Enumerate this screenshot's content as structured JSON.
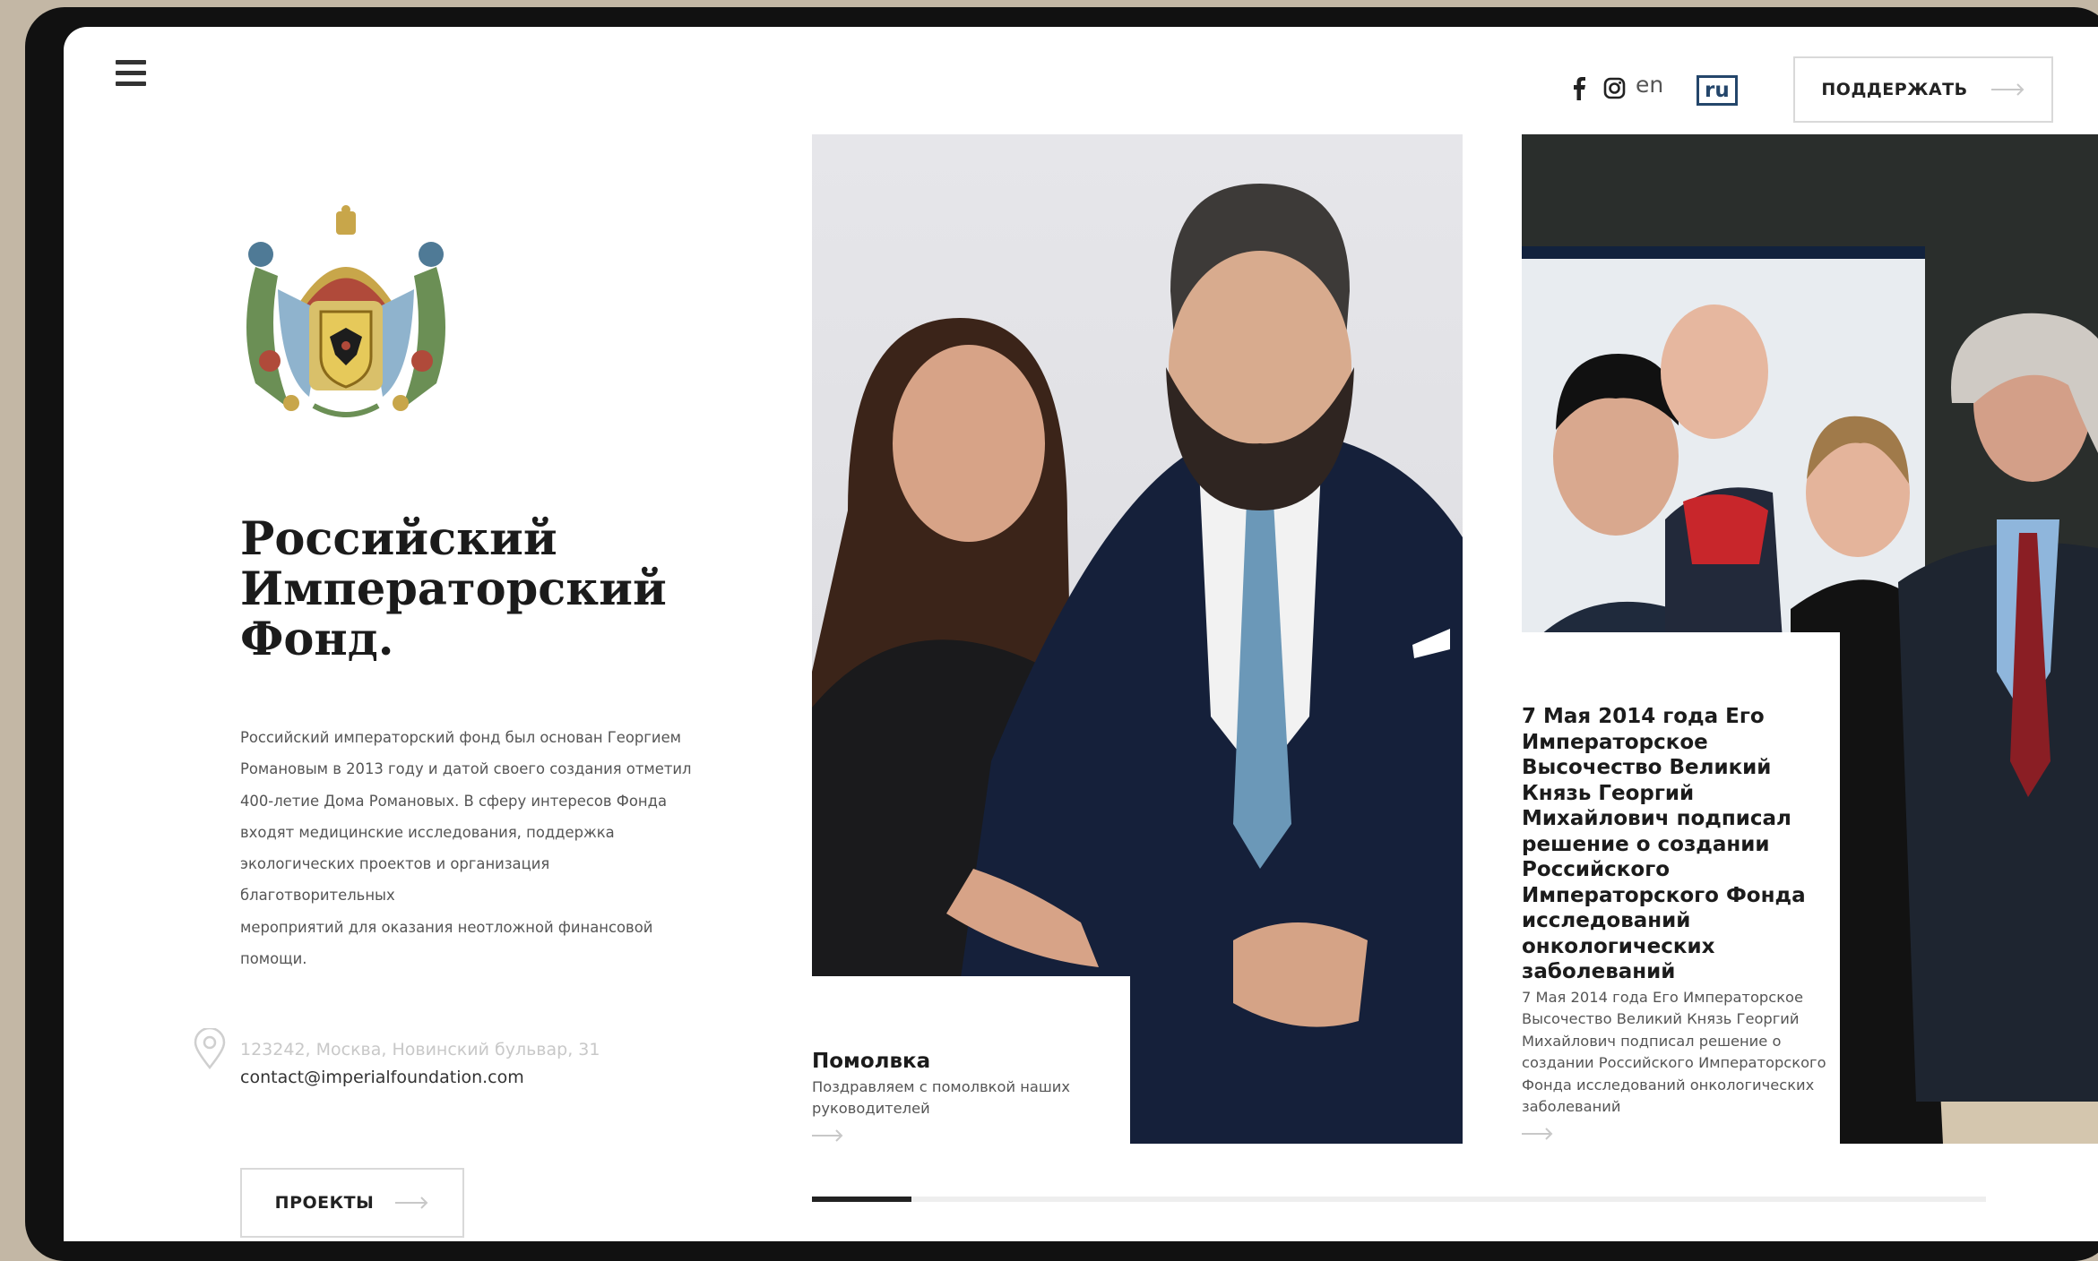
{
  "header": {
    "social": [
      "facebook-icon",
      "instagram-icon"
    ],
    "lang_en": "en",
    "lang_ru": "ru",
    "support_label": "ПОДДЕРЖАТЬ"
  },
  "intro": {
    "title_lines": [
      "Российский",
      "Императорский",
      "Фонд."
    ],
    "description_lines": [
      "Российский императорский фонд был основан Георгием",
      "Романовым в 2013 году и датой своего создания отметил",
      "400-летие Дома Романовых. В сферу интересов Фонда",
      "входят медицинские исследования, поддержка",
      "экологических проектов и организация благотворительных",
      "мероприятий для оказания неотложной финансовой",
      "помощи."
    ],
    "address": "123242, Москва, Новинский бульвар, 31",
    "email": "contact@imperialfoundation.com",
    "projects_label": "ПРОЕКТЫ"
  },
  "cards": [
    {
      "title_lines": [
        "Помолвка"
      ],
      "text_lines": [
        "Поздравляем с помолвкой наших",
        "руководителей"
      ]
    },
    {
      "title_lines": [
        "7 Мая 2014 года Его",
        "Императорское",
        "Высочество Великий",
        "Князь Георгий",
        "Михайлович подписал",
        "решение о создании",
        "Российского",
        "Императорского Фонда",
        "исследований",
        "онкологических",
        "заболеваний"
      ],
      "text_lines": [
        "7 Мая 2014 года Его Императорское",
        "Высочество Великий Князь Георгий",
        "Михайлович подписал решение о",
        "создании Российского Императорского",
        "Фонда исследований онкологических",
        "заболеваний"
      ]
    }
  ],
  "slider": {
    "progress": 0.085
  },
  "colors": {
    "accent": "#24466b",
    "text": "#1b1b1b",
    "muted": "#555555",
    "border": "#d9d9d9"
  }
}
